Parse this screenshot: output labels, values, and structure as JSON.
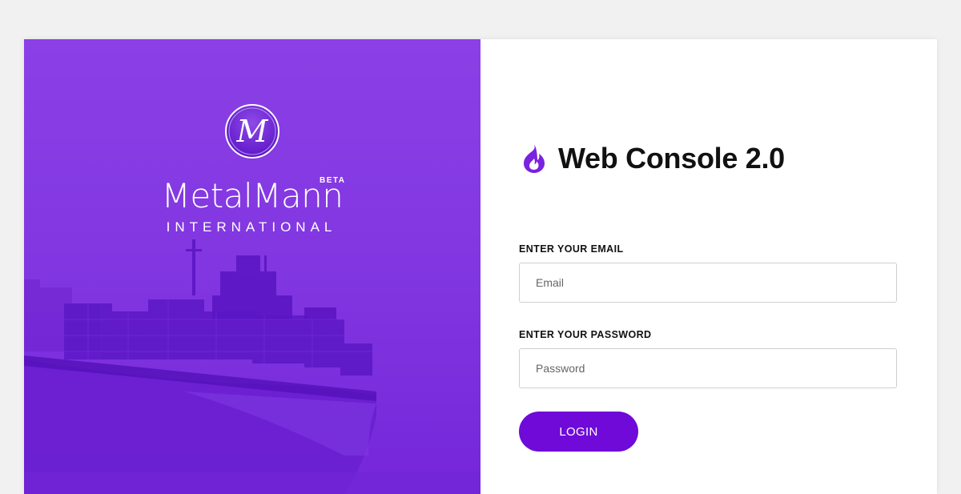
{
  "brand": {
    "monogram": "M",
    "name": "MetalMann",
    "badge": "BETA",
    "subtitle": "INTERNATIONAL"
  },
  "app": {
    "title": "Web Console 2.0",
    "icon": "flame-icon"
  },
  "form": {
    "email_label": "ENTER YOUR EMAIL",
    "email_placeholder": "Email",
    "email_value": "",
    "password_label": "ENTER YOUR PASSWORD",
    "password_placeholder": "Password",
    "password_value": "",
    "login_label": "LOGIN"
  },
  "colors": {
    "accent": "#6f0ad8",
    "hero_overlay": "#8a3ee4",
    "page_background": "#f1f1f1"
  }
}
